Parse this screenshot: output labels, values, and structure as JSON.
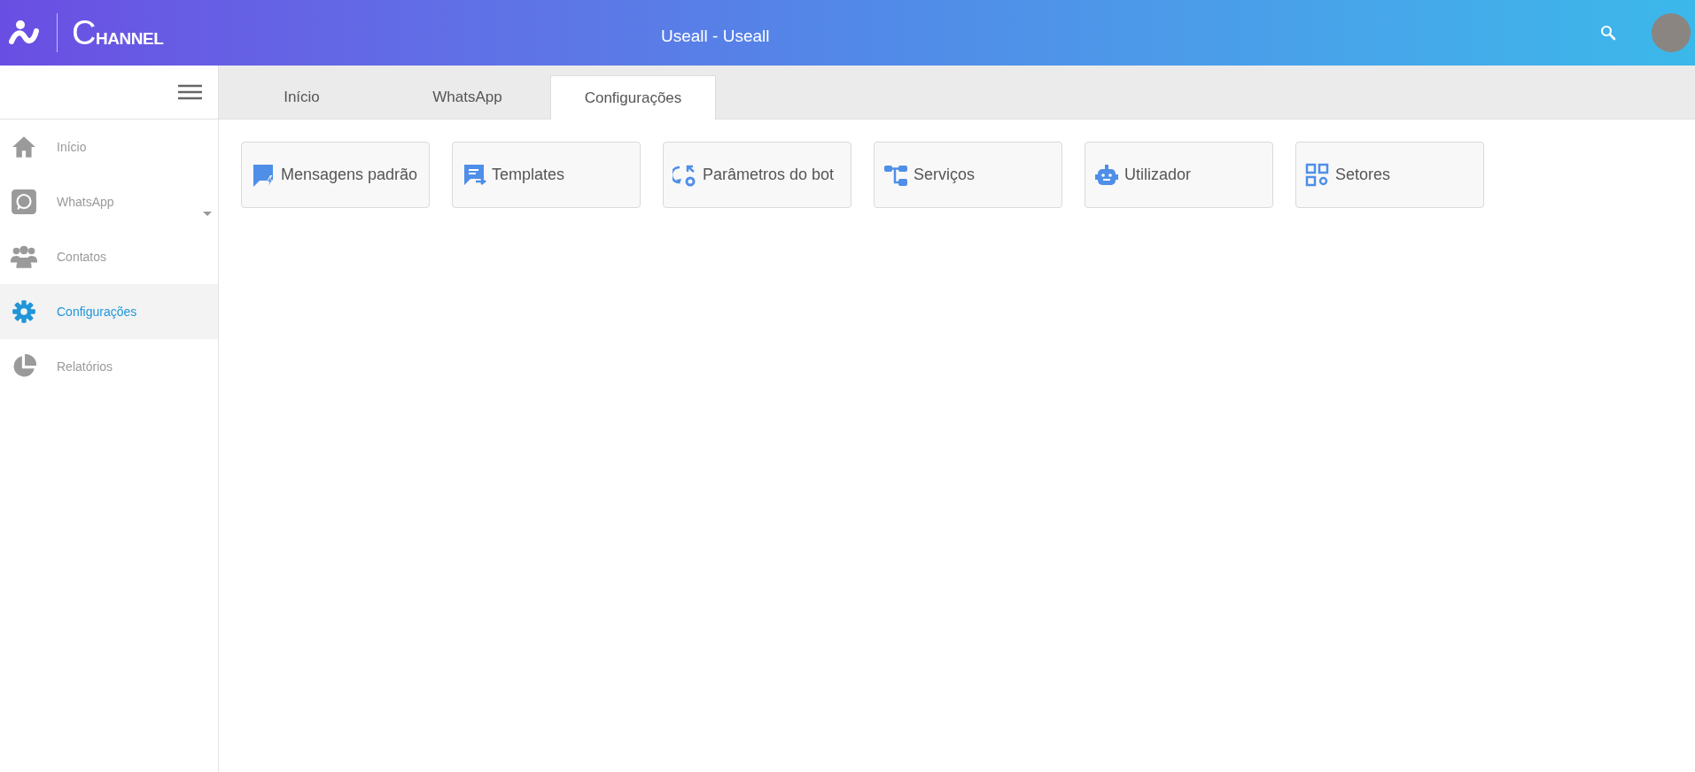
{
  "header": {
    "logo_text": "CHANNEL",
    "title": "Useall - Useall"
  },
  "sidebar": {
    "items": [
      {
        "label": "Início",
        "kind": "home",
        "selected": false,
        "expandable": false
      },
      {
        "label": "WhatsApp",
        "kind": "whatsapp",
        "selected": false,
        "expandable": true
      },
      {
        "label": "Contatos",
        "kind": "contacts",
        "selected": false,
        "expandable": false
      },
      {
        "label": "Configurações",
        "kind": "settings",
        "selected": true,
        "expandable": false
      },
      {
        "label": "Relatórios",
        "kind": "reports",
        "selected": false,
        "expandable": false
      }
    ]
  },
  "tabs": [
    {
      "label": "Início",
      "selected": false
    },
    {
      "label": "WhatsApp",
      "selected": false
    },
    {
      "label": "Configurações",
      "selected": true
    }
  ],
  "cards": [
    {
      "label": "Mensagens padrão",
      "kind": "messages"
    },
    {
      "label": "Templates",
      "kind": "templates"
    },
    {
      "label": "Parâmetros do bot",
      "kind": "params"
    },
    {
      "label": "Serviços",
      "kind": "services"
    },
    {
      "label": "Utilizador",
      "kind": "robot"
    },
    {
      "label": "Setores",
      "kind": "sectors"
    }
  ]
}
